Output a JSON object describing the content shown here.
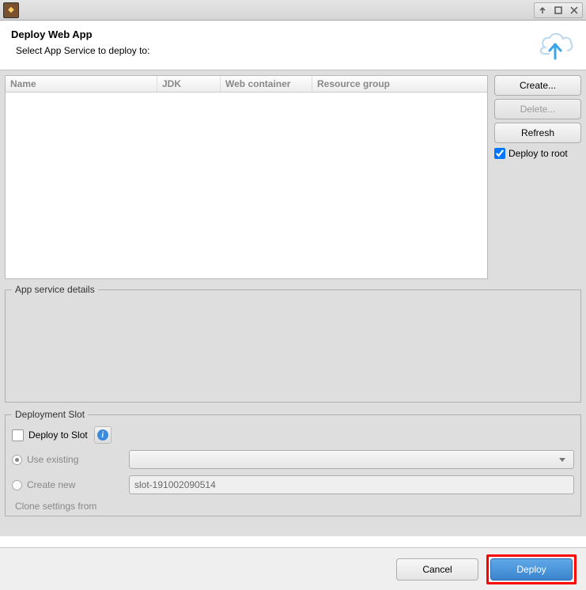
{
  "header": {
    "title": "Deploy Web App",
    "subtitle": "Select App Service to deploy to:"
  },
  "table": {
    "columns": {
      "name": "Name",
      "jdk": "JDK",
      "web": "Web container",
      "rg": "Resource group"
    }
  },
  "side": {
    "create": "Create...",
    "delete": "Delete...",
    "refresh": "Refresh",
    "deploy_root": "Deploy to root"
  },
  "details": {
    "legend": "App service details"
  },
  "slot": {
    "legend": "Deployment Slot",
    "deploy_to_slot": "Deploy to Slot",
    "use_existing": "Use existing",
    "create_new": "Create new",
    "new_value": "slot-191002090514",
    "clone_settings": "Clone settings from"
  },
  "footer": {
    "cancel": "Cancel",
    "deploy": "Deploy"
  }
}
